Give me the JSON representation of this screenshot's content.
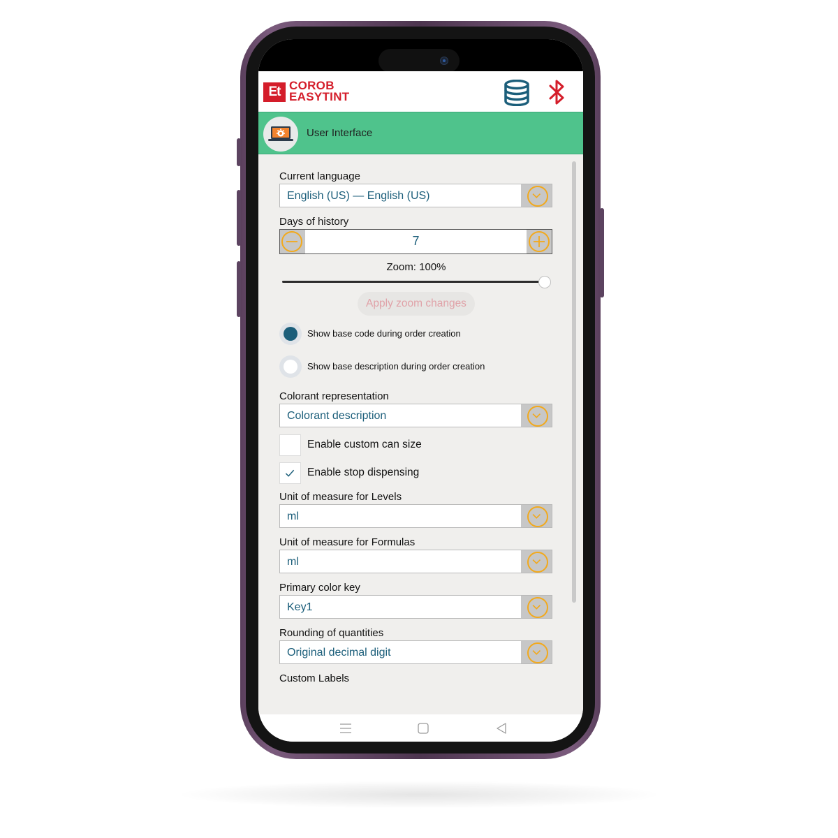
{
  "app": {
    "logo_mark": "Et",
    "logo_line1": "COROB",
    "logo_line2": "EASYTINT",
    "icons": [
      "database-icon",
      "bluetooth-icon"
    ]
  },
  "section": {
    "title": "User Interface",
    "icon": "laptop-settings-icon"
  },
  "settings": {
    "current_language": {
      "label": "Current language",
      "value": "English (US) — English (US)"
    },
    "days_of_history": {
      "label": "Days of history",
      "value": "7"
    },
    "zoom": {
      "label": "Zoom: 100%",
      "level_percent": 100,
      "apply_label": "Apply zoom changes"
    },
    "radios": [
      {
        "label": "Show base code during order creation",
        "selected": true
      },
      {
        "label": "Show base description during order creation",
        "selected": false
      }
    ],
    "colorant_representation": {
      "label": "Colorant representation",
      "value": "Colorant description"
    },
    "checkboxes": [
      {
        "label": "Enable custom can size",
        "checked": false
      },
      {
        "label": "Enable stop dispensing",
        "checked": true
      }
    ],
    "uom_levels": {
      "label": "Unit of measure for Levels",
      "value": "ml"
    },
    "uom_formulas": {
      "label": "Unit of measure for Formulas",
      "value": "ml"
    },
    "primary_color_key": {
      "label": "Primary color key",
      "value": "Key1"
    },
    "rounding": {
      "label": "Rounding of quantities",
      "value": "Original decimal digit"
    },
    "custom_labels": {
      "label": "Custom Labels"
    }
  },
  "colors": {
    "brand_red": "#d41d2a",
    "header_green": "#4fc38c",
    "accent_orange": "#f2a91c",
    "value_blue": "#1b5e7a",
    "phone_frame": "#5a3f5c"
  },
  "navbar": {
    "icons": [
      "menu-icon",
      "home-icon",
      "back-icon"
    ]
  }
}
